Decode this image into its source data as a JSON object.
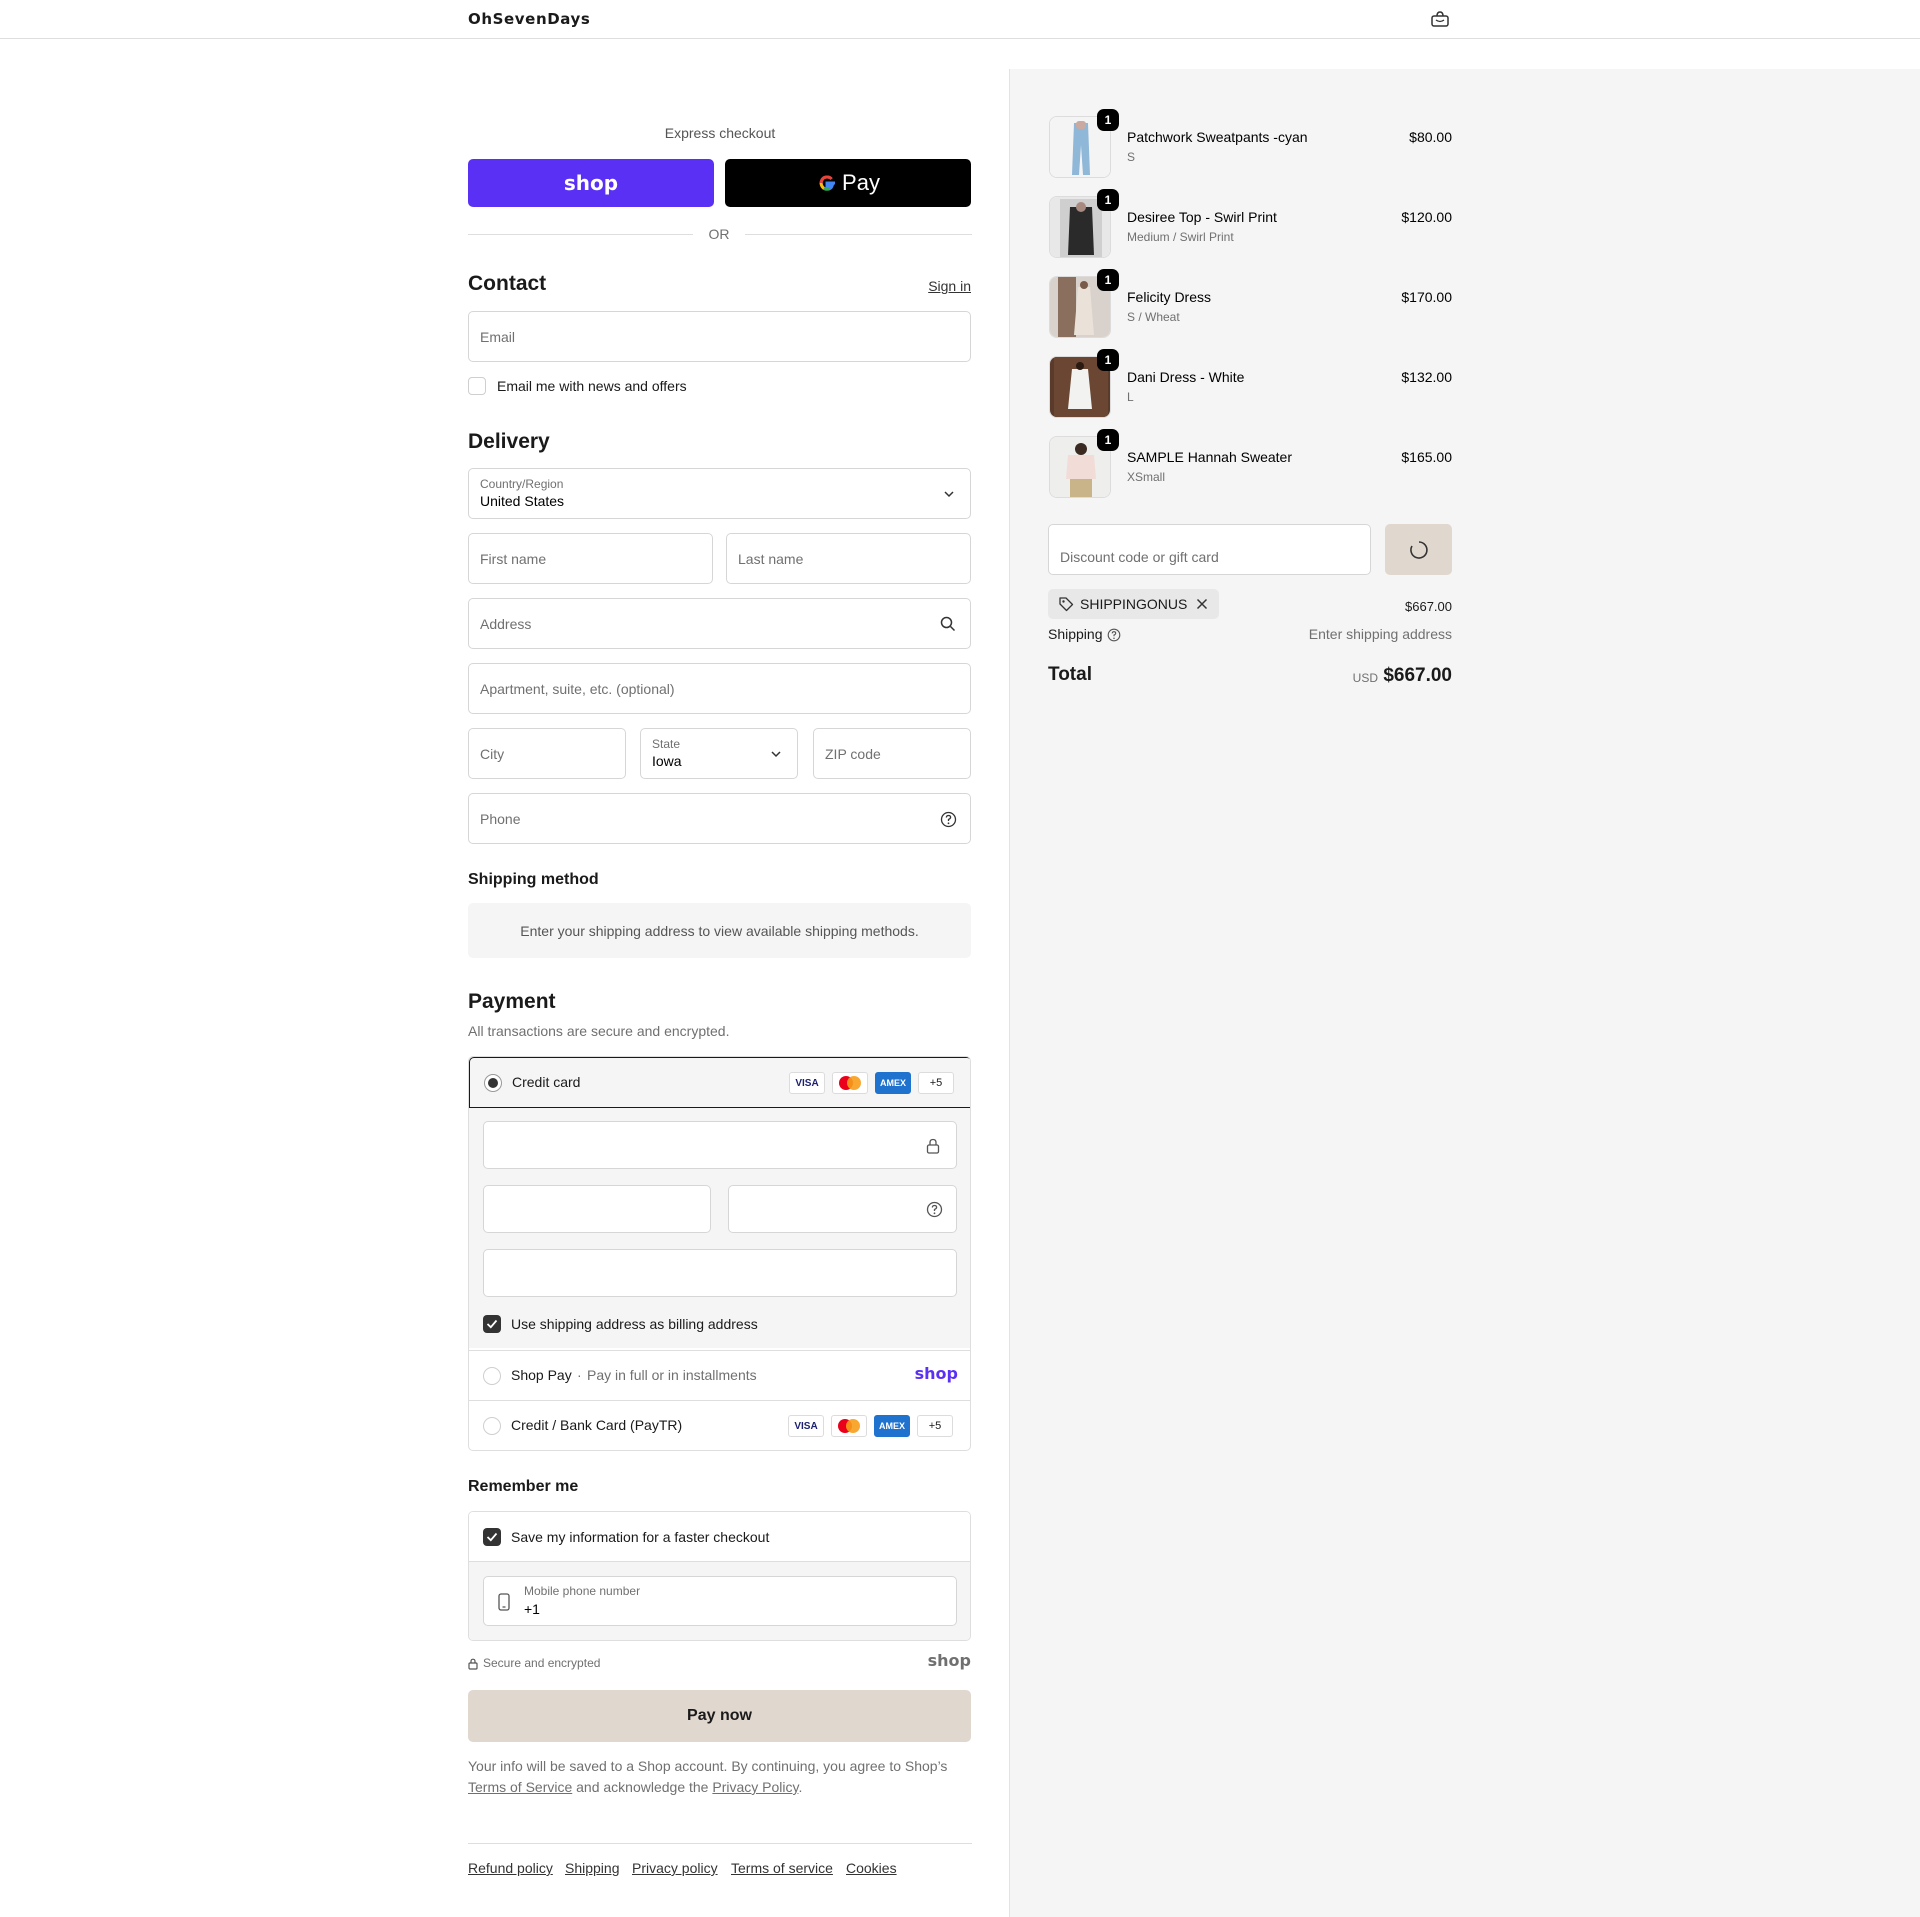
{
  "header": {
    "logo": "OhSevenDays",
    "cart_icon": "bag-icon"
  },
  "express": {
    "label": "Express checkout",
    "shop_label": "shop",
    "gpay_label": "Pay",
    "divider": "OR"
  },
  "contact": {
    "title": "Contact",
    "sign_in": "Sign in",
    "email_placeholder": "Email",
    "news_label": "Email me with news and offers"
  },
  "delivery": {
    "title": "Delivery",
    "country_label": "Country/Region",
    "country_value": "United States",
    "first_name": "First name",
    "last_name": "Last name",
    "address": "Address",
    "apartment": "Apartment, suite, etc. (optional)",
    "city": "City",
    "state_label": "State",
    "state_value": "Iowa",
    "zip": "ZIP code",
    "phone": "Phone"
  },
  "shipping_method": {
    "title": "Shipping method",
    "message": "Enter your shipping address to view available shipping methods."
  },
  "payment": {
    "title": "Payment",
    "subtitle": "All transactions are secure and encrypted.",
    "credit_card": "Credit card",
    "more_cards": "+5",
    "visa": "VISA",
    "amex": "AMEX",
    "billing_same": "Use shipping address as billing address",
    "shop_pay": "Shop Pay",
    "shop_pay_sub": "Pay in full or in installments",
    "shop_logo": "shop",
    "paytr": "Credit / Bank Card (PayTR)"
  },
  "remember": {
    "title": "Remember me",
    "save_label": "Save my information for a faster checkout",
    "mobile_label": "Mobile phone number",
    "mobile_value": "+1",
    "secure": "Secure and encrypted",
    "shop_logo": "shop"
  },
  "pay_now": "Pay now",
  "legal": {
    "text1": "Your info will be saved to a Shop account. By continuing, you agree to Shop’s",
    "terms": "Terms of Service",
    "text2": "and acknowledge the",
    "privacy": "Privacy Policy",
    "text3": "."
  },
  "footer_links": [
    "Refund policy",
    "Shipping",
    "Privacy policy",
    "Terms of service",
    "Cookies"
  ],
  "order": {
    "items": [
      {
        "name": "Patchwork Sweatpants -cyan",
        "variant": "S",
        "price": "$80.00",
        "qty": "1"
      },
      {
        "name": "Desiree Top - Swirl Print",
        "variant": "Medium / Swirl Print",
        "price": "$120.00",
        "qty": "1"
      },
      {
        "name": "Felicity Dress",
        "variant": "S / Wheat",
        "price": "$170.00",
        "qty": "1"
      },
      {
        "name": "Dani Dress - White",
        "variant": "L",
        "price": "$132.00",
        "qty": "1"
      },
      {
        "name": "SAMPLE Hannah Sweater",
        "variant": "XSmall",
        "price": "$165.00",
        "qty": "1"
      }
    ],
    "discount_placeholder": "Discount code or gift card",
    "discount_code": "SHIPPINGONUS",
    "subtotal": "$667.00",
    "shipping_label": "Shipping",
    "shipping_value": "Enter shipping address",
    "total_label": "Total",
    "currency": "USD",
    "total": "$667.00"
  },
  "colors": {
    "shop_purple": "#5a31f4",
    "pay_button": "#e0d7cf",
    "apply_button": "#e0d7cf"
  }
}
